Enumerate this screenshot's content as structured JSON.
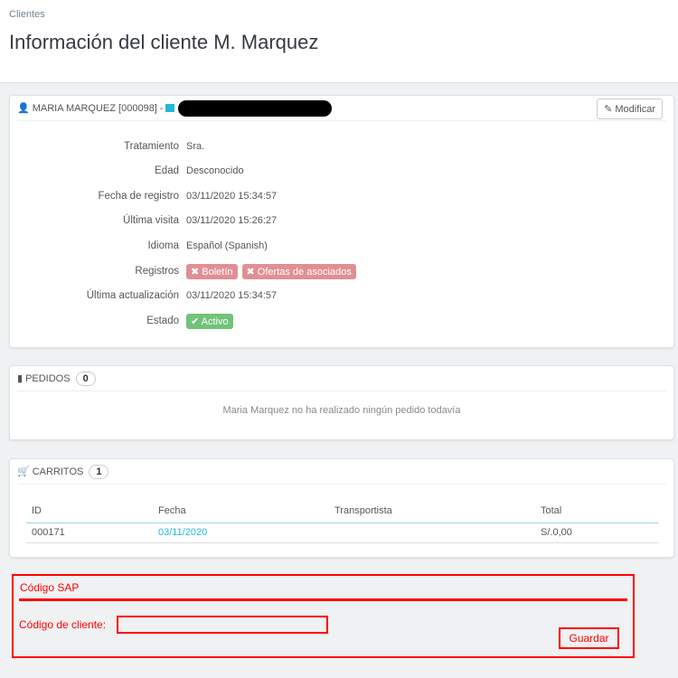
{
  "breadcrumb": "Clientes",
  "page_title": "Información del cliente M. Marquez",
  "customer_panel": {
    "heading": "MARIA MARQUEZ [000098] -",
    "edit_label": "Modificar",
    "fields": [
      {
        "label": "Tratamiento",
        "value": "Sra."
      },
      {
        "label": "Edad",
        "value": "Desconocido"
      },
      {
        "label": "Fecha de registro",
        "value": "03/11/2020 15:34:57"
      },
      {
        "label": "Última visita",
        "value": "03/11/2020 15:26:27"
      },
      {
        "label": "Idioma",
        "value": "Español (Spanish)"
      },
      {
        "label": "Registros",
        "tags": [
          "✖ Boletín",
          "✖ Ofertas de asociados"
        ]
      },
      {
        "label": "Última actualización",
        "value": "03/11/2020 15:34:57"
      },
      {
        "label": "Estado",
        "status": "✔ Activo"
      }
    ]
  },
  "orders_panel": {
    "heading": "Pedidos",
    "count": "0",
    "empty": "Maria Marquez no ha realizado ningún pedido todavía"
  },
  "carts_panel": {
    "heading": "Carritos",
    "count": "1",
    "columns": [
      "ID",
      "Fecha",
      "Transportista",
      "Total"
    ],
    "rows": [
      {
        "id": "000171",
        "date": "03/11/2020",
        "carrier": "",
        "total": "S/.0,00"
      }
    ]
  },
  "sap": {
    "heading": "Código SAP",
    "client_code_label": "Código de cliente:",
    "client_code_value": "",
    "save_label": "Guardar"
  }
}
